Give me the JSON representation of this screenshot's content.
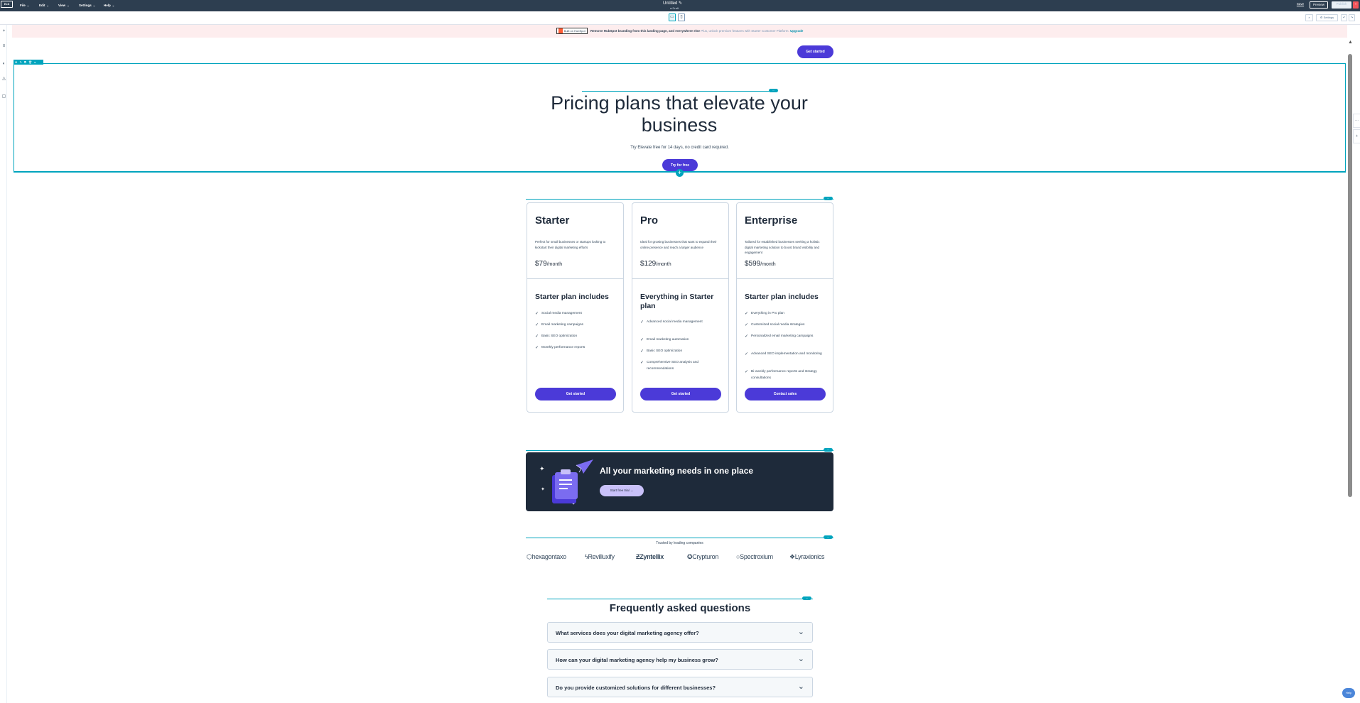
{
  "topbar": {
    "exit_label": "Exit",
    "menus": [
      "File",
      "Edit",
      "View",
      "Settings",
      "Help"
    ],
    "doc_title": "Untitled",
    "doc_status": "● Draft",
    "save_label": "Save",
    "preview_label": "Preview",
    "publish_label": "Publish"
  },
  "subbar": {
    "settings_label": "Settings"
  },
  "banner": {
    "badge": "Built on HubSpot",
    "text": "Remove HubSpot branding from this landing page, and everywhere else",
    "sub": "Plus, unlock premium features with Starter Customer Platform.",
    "link": "Upgrade"
  },
  "header": {
    "cta": "Get started"
  },
  "hero": {
    "title": "Pricing plans that elevate your business",
    "subtitle": "Try Elevate free for 14 days, no credit card required.",
    "cta": "Try for free"
  },
  "plans": [
    {
      "name": "Starter",
      "desc": "Perfect for small businesses or startups looking to kickstart their digital marketing efforts",
      "price": "$79",
      "period": "/month",
      "includes_title": "Starter plan includes",
      "features": [
        "Social media management",
        "Email marketing campaigns",
        "Basic SEO optimization",
        "Monthly performance reports"
      ],
      "cta": "Get started"
    },
    {
      "name": "Pro",
      "desc": "Ideal for growing businesses that want to expand their online presence and reach a larger audience",
      "price": "$129",
      "period": "/month",
      "includes_title": "Everything in Starter plan",
      "features": [
        "Advanced social media management",
        "Email marketing automation",
        "Basic SEO optimization",
        "Comprehensive SEO analysis and recommendations"
      ],
      "cta": "Get started"
    },
    {
      "name": "Enterprise",
      "desc": "Tailored for established businesses seeking a holistic digital marketing solution to boost brand visibility and engagement",
      "price": "$599",
      "period": "/month",
      "includes_title": "Starter plan includes",
      "features": [
        "Everything in Pro plan",
        "Customized social media strategies",
        "Personalized email marketing campaigns",
        "Advanced SEO implementation and monitoring",
        "Bi-weekly performance reports and strategy consultations"
      ],
      "cta": "Contact sales"
    }
  ],
  "promo": {
    "title": "All your marketing needs in one place",
    "cta": "Start free trial"
  },
  "trusted": {
    "label": "Trusted by leading companies",
    "logos": [
      "hexagontaxo",
      "Revilluxify",
      "Zyntellix",
      "Crypturon",
      "Spectroxium",
      "Lyraxionics"
    ]
  },
  "faq": {
    "title": "Frequently asked questions",
    "items": [
      "What services does your digital marketing agency offer?",
      "How can your digital marketing agency help my business grow?",
      "Do you provide customized solutions for different businesses?"
    ]
  },
  "help_label": "Help",
  "colors": {
    "accent": "#4b3ad8",
    "editor_teal": "#00a4bd",
    "dark": "#1e2a3a",
    "topbar": "#2d3e50"
  }
}
